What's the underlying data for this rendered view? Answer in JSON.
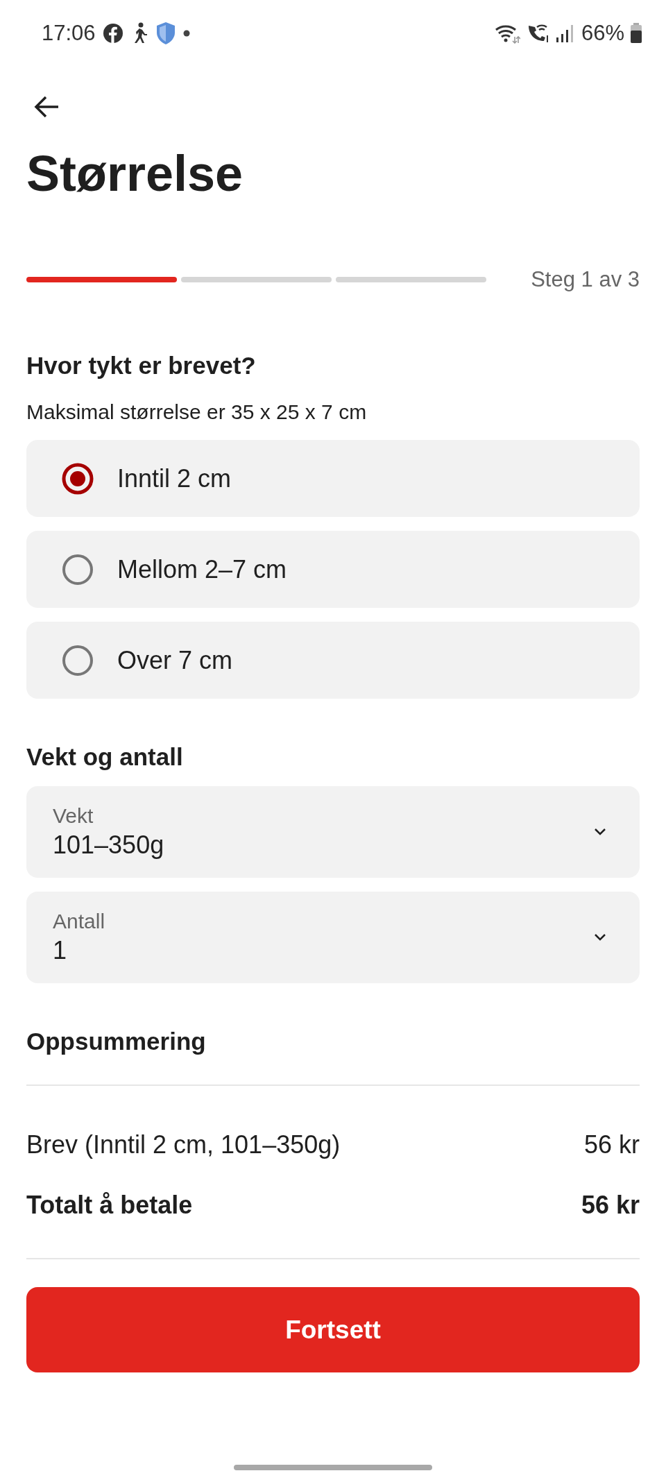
{
  "status_bar": {
    "time": "17:06",
    "battery": "66%"
  },
  "title": "Størrelse",
  "progress": {
    "steps": [
      {
        "done": true
      },
      {
        "done": false
      },
      {
        "done": false
      }
    ],
    "label": "Steg 1 av 3"
  },
  "thickness": {
    "heading": "Hvor tykt er brevet?",
    "hint": "Maksimal størrelse er 35 x 25 x 7 cm",
    "options": [
      {
        "label": "Inntil 2 cm",
        "selected": true
      },
      {
        "label": "Mellom 2–7 cm",
        "selected": false
      },
      {
        "label": "Over 7 cm",
        "selected": false
      }
    ]
  },
  "weight_and_count": {
    "heading": "Vekt og antall",
    "fields": [
      {
        "label": "Vekt",
        "value": "101–350g"
      },
      {
        "label": "Antall",
        "value": "1"
      }
    ]
  },
  "summary": {
    "heading": "Oppsummering",
    "lines": [
      {
        "kind": "item",
        "label": "Brev (Inntil 2 cm, 101–350g)",
        "amount": "56 kr"
      },
      {
        "kind": "total",
        "label": "Totalt å betale",
        "amount": "56 kr"
      }
    ]
  },
  "button": "Fortsett"
}
